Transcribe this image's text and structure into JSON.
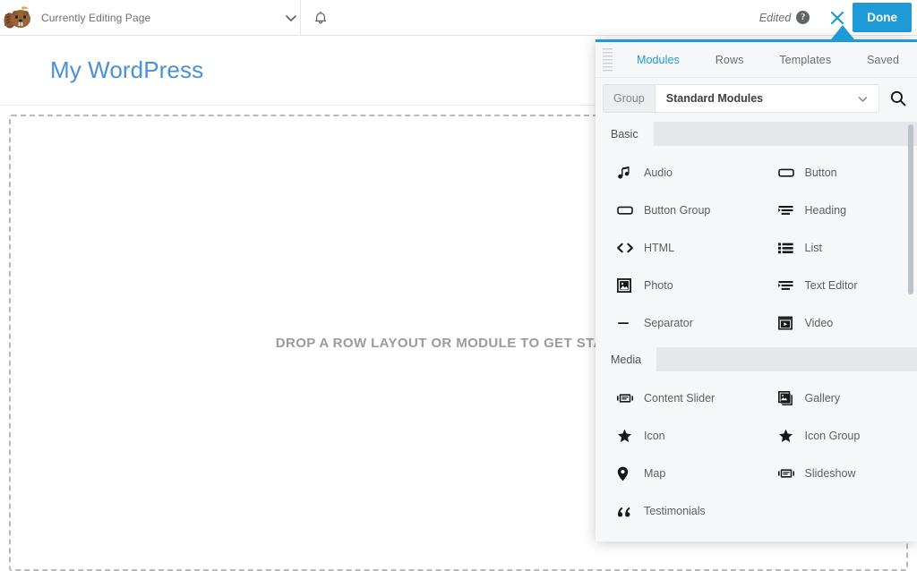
{
  "admin_bar": {
    "logo_icon": "beaver-builder-logo",
    "editing_label": "Currently Editing Page",
    "chevron_icon": "chevron-down-icon",
    "bell_icon": "bell-notification-icon",
    "edited_text": "Edited",
    "help_icon": "help-question-icon",
    "help_char": "?",
    "close_icon": "close-x-icon",
    "done_label": "Done"
  },
  "canvas": {
    "site_title": "My WordPress",
    "drop_text": "DROP A ROW LAYOUT OR MODULE TO GET STARTED"
  },
  "panel": {
    "drag_handle": "panel-drag-handle",
    "tabs": [
      {
        "label": "Modules",
        "active": true
      },
      {
        "label": "Rows",
        "active": false
      },
      {
        "label": "Templates",
        "active": false
      },
      {
        "label": "Saved",
        "active": false
      }
    ],
    "group_label": "Group",
    "group_value": "Standard Modules",
    "group_chevron_icon": "chevron-down-icon",
    "search_icon": "search-icon",
    "sections": [
      {
        "title": "Basic",
        "modules": [
          {
            "label": "Audio",
            "icon": "music-note-icon"
          },
          {
            "label": "Button",
            "icon": "button-rect-icon"
          },
          {
            "label": "Button Group",
            "icon": "button-rect-icon"
          },
          {
            "label": "Heading",
            "icon": "heading-lines-icon"
          },
          {
            "label": "HTML",
            "icon": "code-brackets-icon"
          },
          {
            "label": "List",
            "icon": "bullet-list-icon"
          },
          {
            "label": "Photo",
            "icon": "photo-image-icon"
          },
          {
            "label": "Text Editor",
            "icon": "text-lines-icon"
          },
          {
            "label": "Separator",
            "icon": "horizontal-rule-icon"
          },
          {
            "label": "Video",
            "icon": "video-play-icon"
          }
        ]
      },
      {
        "title": "Media",
        "modules": [
          {
            "label": "Content Slider",
            "icon": "content-slider-icon"
          },
          {
            "label": "Gallery",
            "icon": "gallery-stack-icon"
          },
          {
            "label": "Icon",
            "icon": "star-icon"
          },
          {
            "label": "Icon Group",
            "icon": "star-icon"
          },
          {
            "label": "Map",
            "icon": "map-pin-icon"
          },
          {
            "label": "Slideshow",
            "icon": "slideshow-icon"
          },
          {
            "label": "Testimonials",
            "icon": "quote-marks-icon"
          }
        ]
      }
    ]
  },
  "colors": {
    "accent": "#1e9bd7",
    "site_title": "#4a90d9",
    "panel_bg": "#f6f7f8",
    "section_head_bg": "#e4e8eb"
  }
}
